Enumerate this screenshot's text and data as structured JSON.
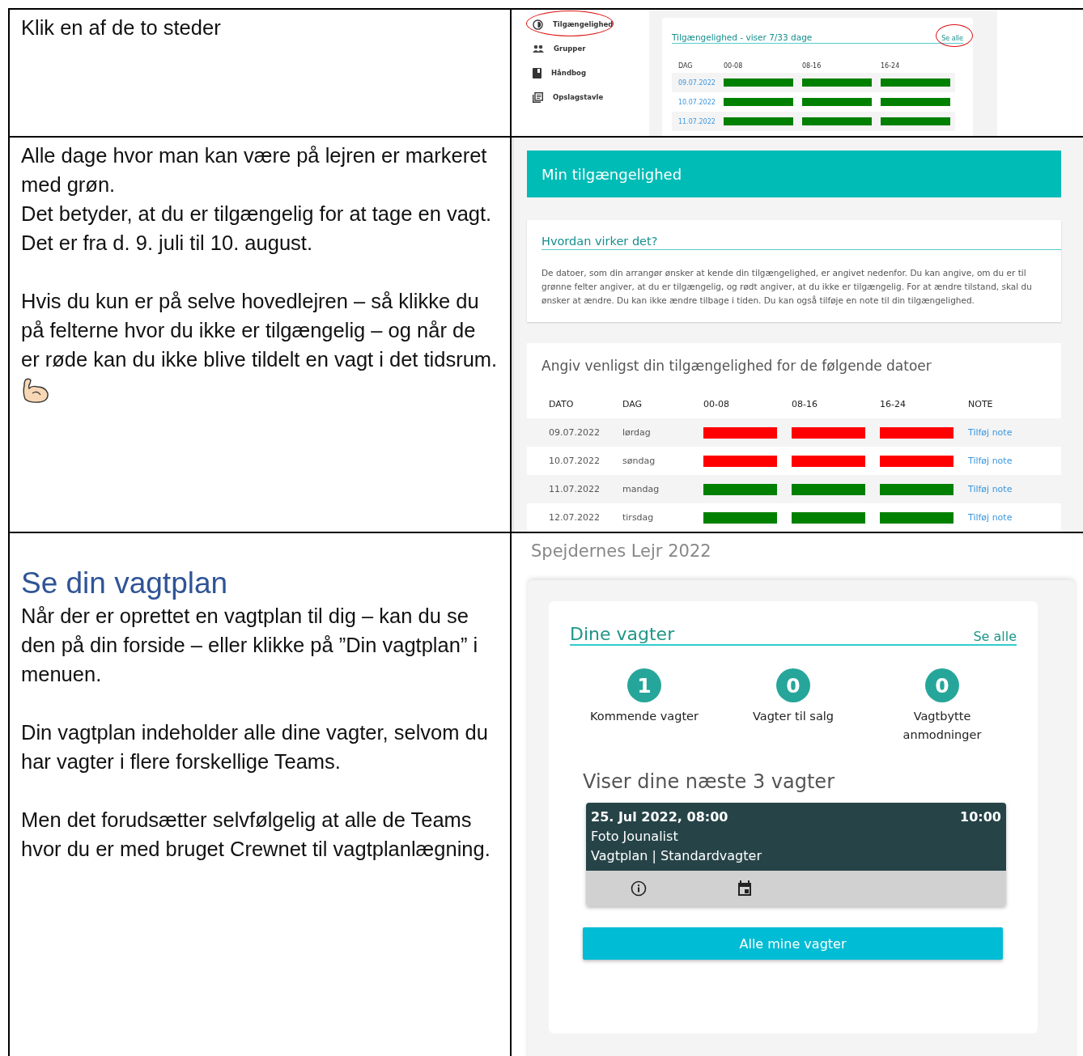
{
  "rows": [
    {
      "paragraphs": [
        [
          "Klik en af de to steder"
        ]
      ]
    },
    {
      "paragraphs": [
        [
          "Alle dage hvor man kan være på lejren er markeret med grøn.",
          "Det betyder, at du er tilgængelig for at tage en vagt.",
          "Det er fra d. 9. juli til 10. august."
        ],
        [
          "Hvis du kun er på selve hovedlejren – så klikke du på felterne hvor du ikke er tilgængelig – og når de er røde kan du ikke blive tildelt en vagt i det tidsrum."
        ]
      ]
    },
    {
      "heading": "Se din vagtplan",
      "paragraphs": [
        [
          "Når der er oprettet en vagtplan til dig – kan du se den på din forside – eller klikke på ”Din vagtplan” i menuen."
        ],
        [
          "Din vagtplan indeholder alle dine vagter, selvom du har vagter i flere forskellige Teams."
        ],
        [
          "Men det forudsætter selvfølgelig at alle de Teams hvor du er med bruget Crewnet til vagtplanlægning."
        ]
      ]
    }
  ],
  "sidebar": {
    "items": [
      {
        "label": "Tilgængelighed",
        "kind": "clock",
        "circled": true
      },
      {
        "label": "Grupper",
        "kind": "people",
        "circled": false
      },
      {
        "label": "Håndbog",
        "kind": "book",
        "circled": false
      },
      {
        "label": "Opslagstavle",
        "kind": "board",
        "circled": false
      }
    ]
  },
  "availability_widget": {
    "title": "Tilgængelighed - viser 7/33 dage",
    "see_all": "Se alle",
    "see_all_circled": true,
    "columns": [
      "DAG",
      "00-08",
      "08-16",
      "16-24"
    ],
    "rows": [
      {
        "date": "09.07.2022",
        "slots": [
          {
            "available": true
          },
          {
            "available": true
          },
          {
            "available": true
          }
        ]
      },
      {
        "date": "10.07.2022",
        "slots": [
          {
            "available": true
          },
          {
            "available": true
          },
          {
            "available": true
          }
        ]
      },
      {
        "date": "11.07.2022",
        "slots": [
          {
            "available": true
          },
          {
            "available": true
          },
          {
            "available": true
          }
        ]
      }
    ]
  },
  "availability_page": {
    "title": "Min tilgængelighed",
    "help_title": "Hvordan virker det?",
    "help_lines": [
      "De datoer, som din arrangør ønsker at kende din tilgængelighed, er angivet nedenfor. Du kan angive, om du er til",
      "grønne felter angiver, at du er tilgængelig, og rødt angiver, at du ikke er tilgængelig. For at ændre tilstand, skal du",
      "ønsker at ændre. Du kan ikke ændre tilbage i tiden. Du kan også tilføje en note til din tilgængelighed."
    ],
    "table_title": "Angiv venligst din tilgængelighed for de følgende datoer",
    "columns": [
      "DATO",
      "DAG",
      "00-08",
      "08-16",
      "16-24",
      "NOTE"
    ],
    "rows": [
      {
        "date": "09.07.2022",
        "day": "lørdag",
        "slots": [
          {
            "available": false
          },
          {
            "available": false
          },
          {
            "available": false
          }
        ],
        "note": "Tilføj note"
      },
      {
        "date": "10.07.2022",
        "day": "søndag",
        "slots": [
          {
            "available": false
          },
          {
            "available": false
          },
          {
            "available": false
          }
        ],
        "note": "Tilføj note"
      },
      {
        "date": "11.07.2022",
        "day": "mandag",
        "slots": [
          {
            "available": true
          },
          {
            "available": true
          },
          {
            "available": true
          }
        ],
        "note": "Tilføj note"
      },
      {
        "date": "12.07.2022",
        "day": "tirsdag",
        "slots": [
          {
            "available": true
          },
          {
            "available": true
          },
          {
            "available": true
          }
        ],
        "note": "Tilføj note"
      }
    ]
  },
  "dashboard": {
    "event_title": "Spejdernes Lejr 2022",
    "card_title": "Dine vagter",
    "see_all": "Se alle",
    "stats": [
      {
        "count": "1",
        "label": "Kommende vagter"
      },
      {
        "count": "0",
        "label": "Vagter til salg"
      },
      {
        "count": "0",
        "label": "Vagtbytte anmodninger"
      }
    ],
    "next_title": "Viser dine næste 3 vagter",
    "shift": {
      "start": "25. Jul 2022, 08:00",
      "end": "10:00",
      "role": "Foto Jounalist",
      "plan": "Vagtplan | Standardvagter"
    },
    "button": "Alle mine vagter"
  }
}
